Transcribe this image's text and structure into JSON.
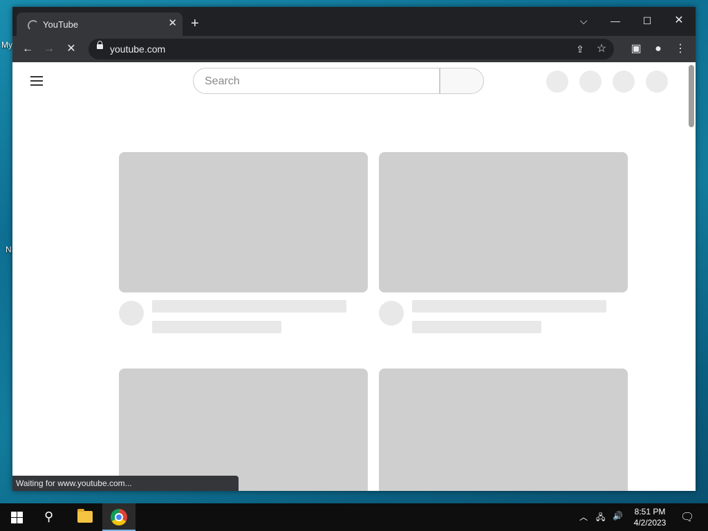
{
  "browser": {
    "tab_title": "YouTube",
    "url": "youtube.com",
    "status_text": "Waiting for www.youtube.com..."
  },
  "youtube": {
    "search_placeholder": "Search"
  },
  "taskbar": {
    "time": "8:51 PM",
    "date": "4/2/2023"
  },
  "desktop": {
    "icon_label_fragment_1": "My",
    "icon_label_fragment_2": "N"
  }
}
